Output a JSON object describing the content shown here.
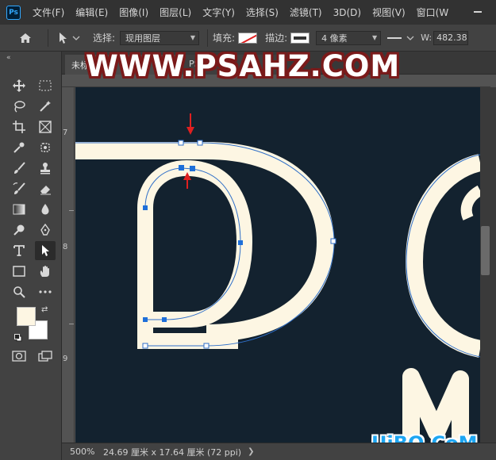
{
  "app": {
    "logo_text": "Ps"
  },
  "menu": [
    "文件(F)",
    "编辑(E)",
    "图像(I)",
    "图层(L)",
    "文字(Y)",
    "选择(S)",
    "滤镜(T)",
    "3D(D)",
    "视图(V)",
    "窗口(W"
  ],
  "options": {
    "select_label": "选择:",
    "select_value": "现用图层",
    "fill_label": "填充:",
    "stroke_label": "描边:",
    "stroke_width": "4 像素",
    "width_label": "W:",
    "width_value": "482.38"
  },
  "tabs": [
    {
      "label": "未标"
    },
    {
      "label": "PSAH"
    }
  ],
  "ruler": {
    "marks": [
      "7",
      "8",
      "9"
    ]
  },
  "canvas": {
    "background": "#13222f",
    "stroke_color": "#fdf6e3",
    "path_color": "#1e6fd9",
    "arrow_color": "#e02020"
  },
  "colors": {
    "foreground": "#fdf6e3",
    "background": "#ffffff"
  },
  "status": {
    "zoom": "500%",
    "doc_info": "24.69 厘米 x 17.64 厘米 (72 ppi)",
    "arrow": "❯"
  },
  "watermark": {
    "top": "WWW.PSAHZ.COM",
    "bottom": "UiBQ.CoM"
  }
}
